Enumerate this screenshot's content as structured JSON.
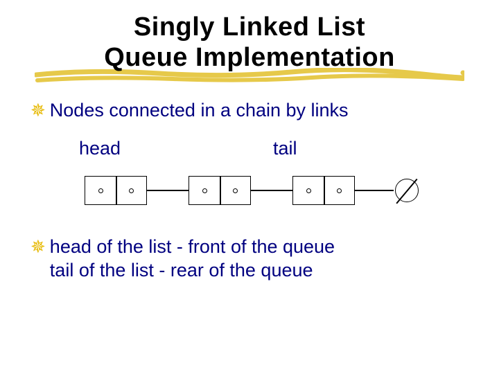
{
  "title": {
    "line1": "Singly Linked List",
    "line2": "Queue Implementation"
  },
  "bullets": {
    "b1": "Nodes connected in a chain by links",
    "b2_line1": "head of the list - front of the queue",
    "b2_line2": "tail of the list - rear of the queue"
  },
  "labels": {
    "head": "head",
    "tail": "tail"
  },
  "diagram": {
    "node_count": 3,
    "terminator": "null"
  }
}
